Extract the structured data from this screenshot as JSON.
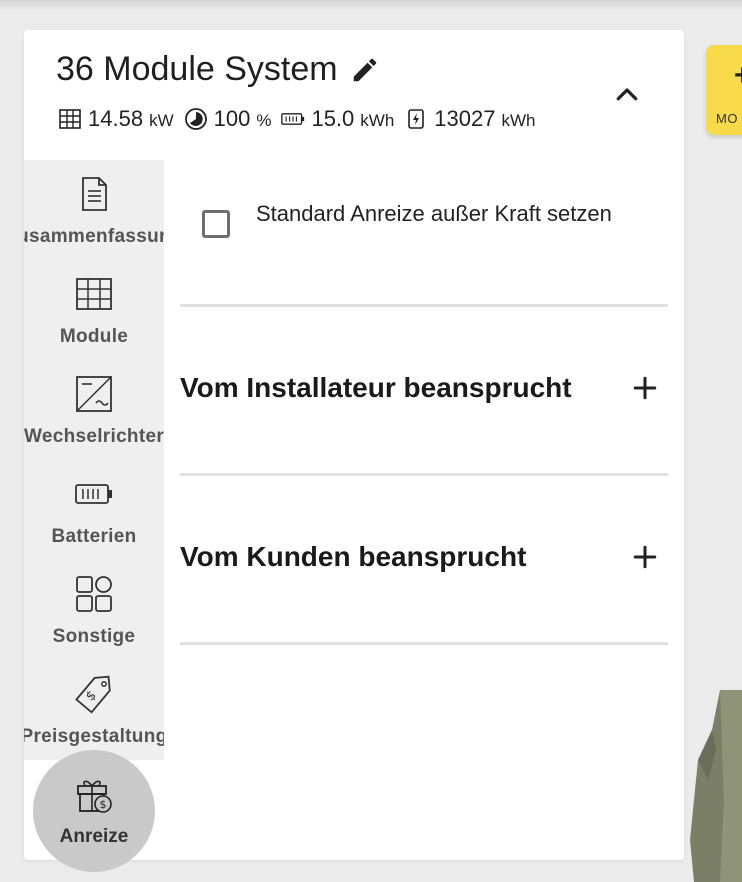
{
  "system": {
    "title": "36 Module System",
    "stats": [
      {
        "icon": "solar-panel-icon",
        "value": "14.58",
        "unit": "kW"
      },
      {
        "icon": "offset-pie-icon",
        "value": "100",
        "unit": "%"
      },
      {
        "icon": "battery-icon",
        "value": "15.0",
        "unit": "kWh"
      },
      {
        "icon": "energy-bolt-icon",
        "value": "13027",
        "unit": "kWh"
      }
    ]
  },
  "sidebar": {
    "items": [
      {
        "label": "Zusammenfassung",
        "icon": "document-icon"
      },
      {
        "label": "Module",
        "icon": "solar-panel-icon"
      },
      {
        "label": "Wechselrichter",
        "icon": "inverter-icon"
      },
      {
        "label": "Batterien",
        "icon": "battery-icon"
      },
      {
        "label": "Sonstige",
        "icon": "grid-shapes-icon"
      },
      {
        "label": "Preisgestaltung",
        "icon": "price-tag-icon"
      },
      {
        "label": "Anreize",
        "icon": "gift-dollar-icon"
      }
    ]
  },
  "content": {
    "checkbox_label": "Standard Anreize außer Kraft setzen",
    "sections": [
      {
        "title": "Vom Installateur beansprucht"
      },
      {
        "title": "Vom Kunden beansprucht"
      }
    ]
  },
  "right_card": {
    "label": "MO",
    "symbol": "+"
  },
  "colors": {
    "accent_yellow": "#f7d94a",
    "active_tab": "#c9c9c9",
    "sidebar_bg": "#efefef"
  }
}
